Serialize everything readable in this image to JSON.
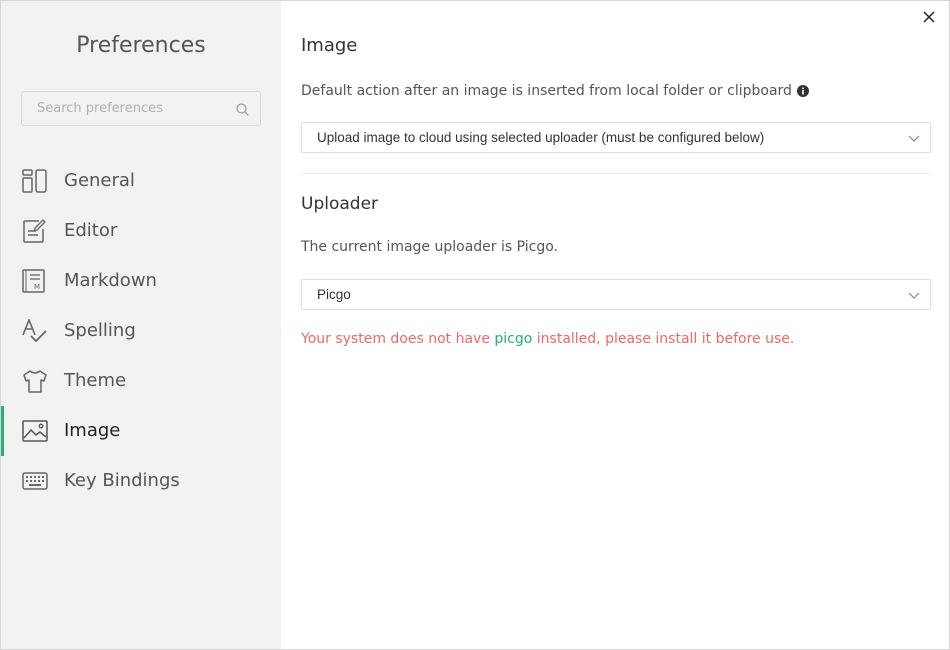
{
  "sidebar": {
    "title": "Preferences",
    "search": {
      "placeholder": "Search preferences",
      "value": ""
    },
    "items": [
      {
        "label": "General",
        "icon": "general-icon"
      },
      {
        "label": "Editor",
        "icon": "editor-icon"
      },
      {
        "label": "Markdown",
        "icon": "markdown-icon"
      },
      {
        "label": "Spelling",
        "icon": "spelling-icon"
      },
      {
        "label": "Theme",
        "icon": "theme-icon"
      },
      {
        "label": "Image",
        "icon": "image-icon",
        "active": true
      },
      {
        "label": "Key Bindings",
        "icon": "keyboard-icon"
      }
    ]
  },
  "main": {
    "image_section": {
      "title": "Image",
      "description": "Default action after an image is inserted from local folder or clipboard",
      "action_select": {
        "value": "Upload image to cloud using selected uploader (must be configured below)"
      }
    },
    "uploader_section": {
      "title": "Uploader",
      "description": "The current image uploader is Picgo.",
      "uploader_select": {
        "value": "Picgo"
      },
      "warning": {
        "prefix": "Your system does not have ",
        "link": "picgo",
        "suffix": " installed, please install it before use."
      }
    }
  },
  "colors": {
    "accent": "#2aad78",
    "warning": "#ec6a6a",
    "sidebar_bg": "#f2f2f2"
  }
}
